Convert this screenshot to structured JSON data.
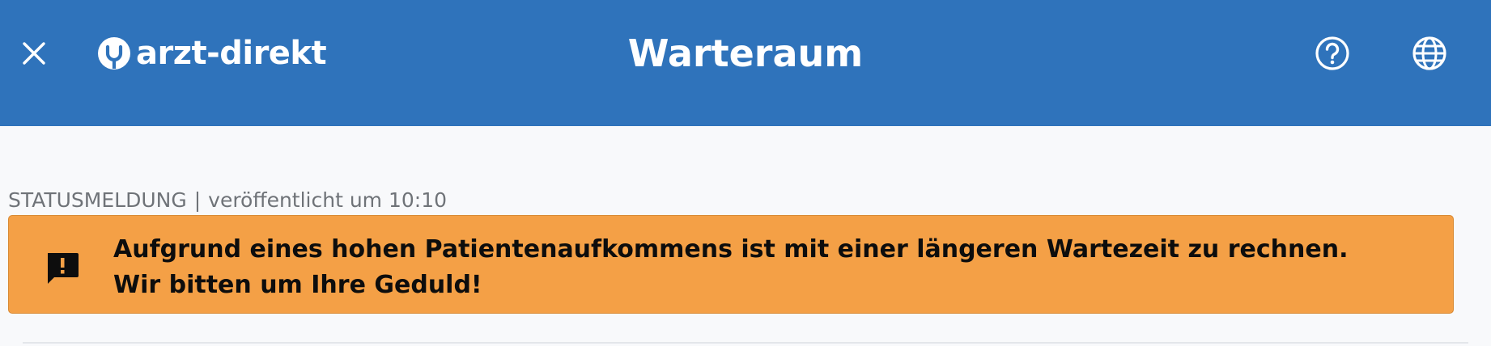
{
  "header": {
    "brand": "arzt-direkt",
    "title": "Warteraum",
    "background_color": "#2f73bb",
    "icons": {
      "close": "close-icon",
      "logo": "arzt-direkt-logo-icon",
      "help": "help-circle-icon",
      "language": "globe-icon"
    }
  },
  "status": {
    "label": "STATUSMELDUNG",
    "separator": "|",
    "published": "veröffentlicht um 10:10",
    "message_line1": "Aufgrund eines hohen Patientenaufkommens ist mit einer längeren Wartezeit zu rechnen.",
    "message_line2": "Wir bitten um Ihre Geduld!",
    "icon": "alert-message-icon",
    "accent_color": "#f4a046"
  }
}
